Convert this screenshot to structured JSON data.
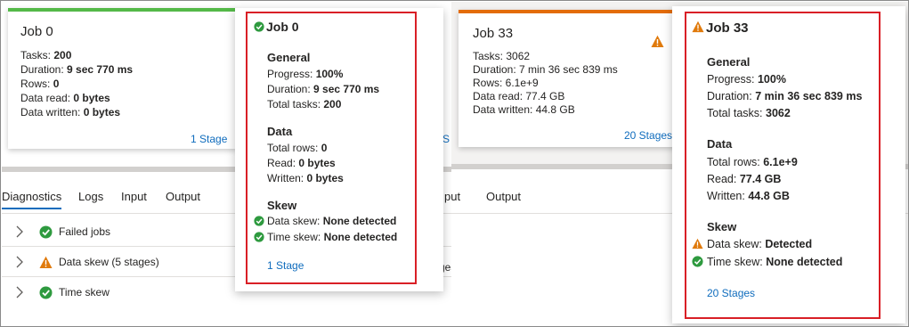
{
  "colors": {
    "success": "#2e9a3f",
    "warning": "#e07a0c",
    "bar_green": "#54b948",
    "bar_orange": "#e36c09",
    "link": "#0f6cbd",
    "highlight": "#d91f26"
  },
  "left": {
    "card": {
      "title": "Job 0",
      "tasks_label": "Tasks: ",
      "tasks": "200",
      "duration_label": "Duration: ",
      "duration": "9 sec 770 ms",
      "rows_label": "Rows: ",
      "rows": "0",
      "read_label": "Data read: ",
      "read": "0 bytes",
      "written_label": "Data written: ",
      "written": "0 bytes",
      "stages_link": "1 Stage"
    },
    "tabs": [
      "Diagnostics",
      "Logs",
      "Input",
      "Output"
    ],
    "diagnostics": [
      {
        "label": "Failed jobs",
        "icon": "success-check-icon"
      },
      {
        "label": "Data skew (5 stages)",
        "icon": "warning-icon"
      },
      {
        "label": "Time skew",
        "icon": "success-check-icon"
      }
    ],
    "popup": {
      "title": "Job 0",
      "general_heading": "General",
      "progress_label": "Progress: ",
      "progress": "100%",
      "duration_label": "Duration: ",
      "duration": "9 sec 770 ms",
      "tasks_label": "Total tasks: ",
      "tasks": "200",
      "data_heading": "Data",
      "rows_label": "Total rows: ",
      "rows": "0",
      "read_label": "Read: ",
      "read": "0 bytes",
      "written_label": "Written: ",
      "written": "0 bytes",
      "skew_heading": "Skew",
      "data_skew_label": "Data skew: ",
      "data_skew": "None detected",
      "time_skew_label": "Time skew: ",
      "time_skew": "None detected",
      "stages_link": "1 Stage"
    }
  },
  "right": {
    "card": {
      "title": "Job 33",
      "tasks": "Tasks: 3062",
      "duration": "Duration: 7 min 36 sec 839 ms",
      "rows": "Rows: 6.1e+9",
      "read": "Data read: 77.4 GB",
      "written": "Data written: 44.8 GB",
      "stages_link": "20 Stages"
    },
    "tabs_partial": [
      "put",
      "Output"
    ],
    "partial_row_text": "ges)",
    "partial_edge_link": "S",
    "popup": {
      "title": "Job 33",
      "general_heading": "General",
      "progress_label": "Progress: ",
      "progress": "100%",
      "duration_label": "Duration: ",
      "duration": "7 min 36 sec 839 ms",
      "tasks_label": "Total tasks: ",
      "tasks": "3062",
      "data_heading": "Data",
      "rows_label": "Total rows: ",
      "rows": "6.1e+9",
      "read_label": "Read: ",
      "read": "77.4 GB",
      "written_label": "Written: ",
      "written": "44.8 GB",
      "skew_heading": "Skew",
      "data_skew_label": "Data skew: ",
      "data_skew": "Detected",
      "time_skew_label": "Time skew: ",
      "time_skew": "None detected",
      "stages_link": "20 Stages"
    }
  }
}
